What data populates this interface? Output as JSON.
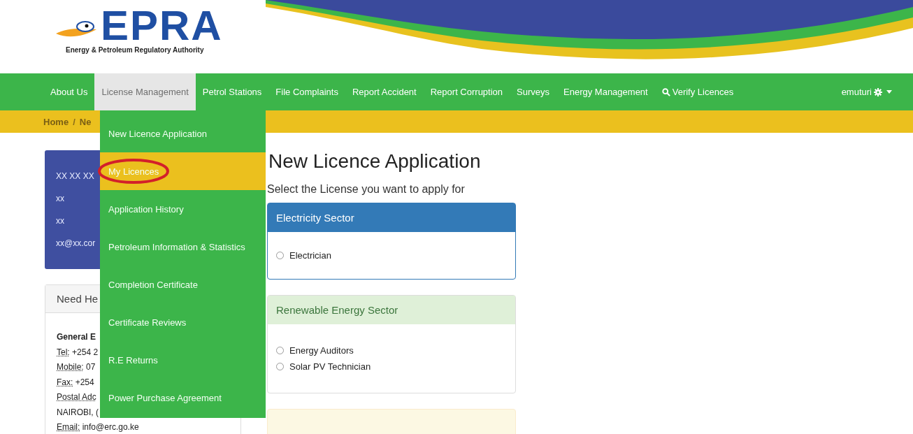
{
  "logo": {
    "name": "EPRA",
    "tagline": "Energy & Petroleum Regulatory Authority"
  },
  "nav": {
    "items": [
      {
        "label": "About Us",
        "selected": false
      },
      {
        "label": "License Management",
        "selected": true
      },
      {
        "label": "Petrol Stations",
        "selected": false
      },
      {
        "label": "File Complaints",
        "selected": false
      },
      {
        "label": "Report Accident",
        "selected": false
      },
      {
        "label": "Report Corruption",
        "selected": false
      },
      {
        "label": "Surveys",
        "selected": false
      },
      {
        "label": "Energy Management",
        "selected": false
      },
      {
        "label": "Verify Licences",
        "selected": false,
        "kind": "search"
      }
    ],
    "user": "emuturi"
  },
  "breadcrumb": [
    "Home",
    "/",
    "Ne"
  ],
  "dropdown": [
    {
      "label": "New Licence Application",
      "selected": false,
      "circled": false
    },
    {
      "label": "My Licences",
      "selected": true,
      "circled": true
    },
    {
      "label": "Application History",
      "selected": false,
      "circled": false
    },
    {
      "label": "Petroleum Information & Statistics",
      "selected": false,
      "circled": false
    },
    {
      "label": "Completion Certificate",
      "selected": false,
      "circled": false
    },
    {
      "label": "Certificate Reviews",
      "selected": false,
      "circled": false
    },
    {
      "label": "R.E Returns",
      "selected": false,
      "circled": false
    },
    {
      "label": "Power Purchase Agreement",
      "selected": false,
      "circled": false
    }
  ],
  "profile": [
    "XX XX XX",
    "xx",
    "xx",
    "xx@xx.cor"
  ],
  "help": {
    "title": "Need He",
    "heading": "General E",
    "lines": [
      {
        "label": "Tel:",
        "value": " +254 2"
      },
      {
        "label": "Mobile:",
        "value": " 07"
      },
      {
        "label": "Fax:",
        "value": " +254"
      },
      {
        "label": "Postal Adc"
      },
      {
        "value": "NAIROBI, ("
      },
      {
        "label": "Email:",
        "value": " info@erc.go.ke"
      }
    ]
  },
  "main": {
    "title": "New Licence Application",
    "subtitle": "Select the License you want to apply for",
    "sectors": [
      {
        "title": "Electricity Sector",
        "kind": "primary",
        "options": [
          {
            "label": "Electrician",
            "checked": false
          }
        ]
      },
      {
        "title": "Renewable Energy Sector",
        "kind": "success",
        "options": [
          {
            "label": "Energy Auditors",
            "checked": false
          },
          {
            "label": "Solar PV Technician",
            "checked": false
          }
        ]
      },
      {
        "kind": "warning"
      }
    ]
  }
}
